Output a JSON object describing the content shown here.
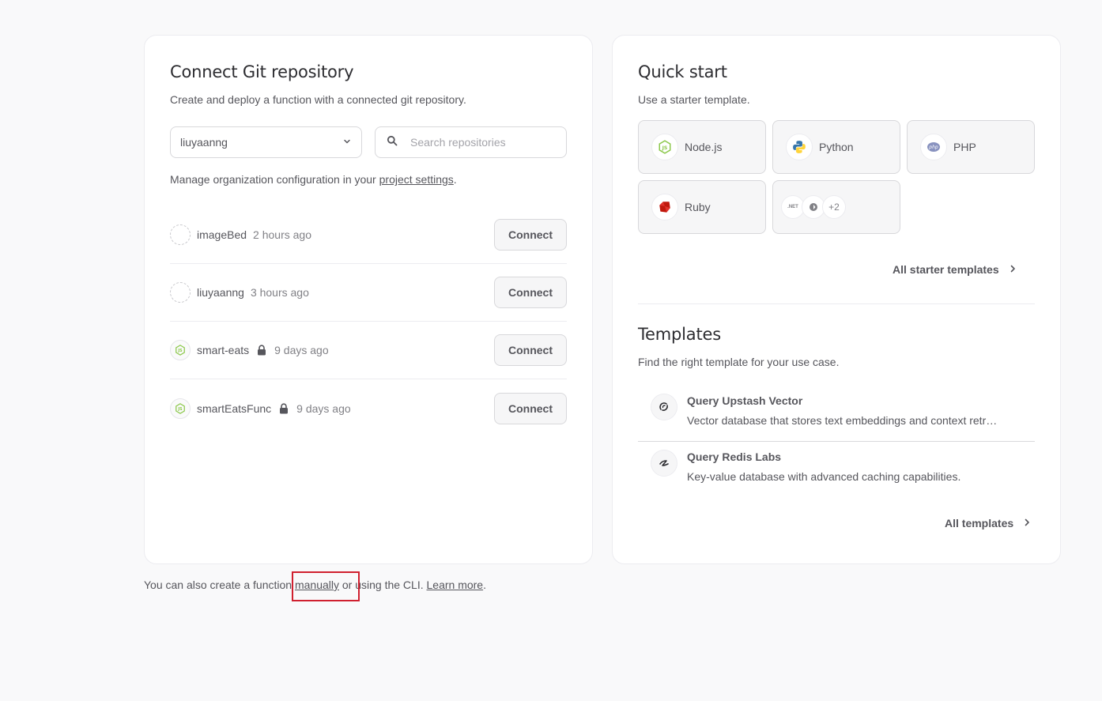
{
  "git": {
    "title": "Connect Git repository",
    "subtitle": "Create and deploy a function with a connected git repository.",
    "org_select": "liuyaanng",
    "search_placeholder": "Search repositories",
    "manage_prefix": "Manage organization configuration in your ",
    "manage_link": "project settings",
    "manage_suffix": ".",
    "connect_label": "Connect",
    "repos": [
      {
        "name": "imageBed",
        "time": "2 hours ago",
        "private": false,
        "icon": "empty-avatar-icon"
      },
      {
        "name": "liuyaanng",
        "time": "3 hours ago",
        "private": false,
        "icon": "empty-avatar-icon"
      },
      {
        "name": "smart-eats",
        "time": "9 days ago",
        "private": true,
        "icon": "nodejs-icon"
      },
      {
        "name": "smartEatsFunc",
        "time": "9 days ago",
        "private": true,
        "icon": "nodejs-icon"
      }
    ]
  },
  "quickstart": {
    "title": "Quick start",
    "subtitle": "Use a starter template.",
    "starters": [
      {
        "label": "Node.js",
        "icon": "nodejs-icon"
      },
      {
        "label": "Python",
        "icon": "python-icon"
      },
      {
        "label": "PHP",
        "icon": "php-icon"
      },
      {
        "label": "Ruby",
        "icon": "ruby-icon"
      }
    ],
    "more_starters": {
      "dotnet": ".NET",
      "count": "+2"
    },
    "all_starters_label": "All starter templates"
  },
  "templates": {
    "title": "Templates",
    "subtitle": "Find the right template for your use case.",
    "items": [
      {
        "title": "Query Upstash Vector",
        "desc": "Vector database that stores text embeddings and context retr…",
        "icon": "upstash-icon"
      },
      {
        "title": "Query Redis Labs",
        "desc": "Key-value database with advanced caching capabilities.",
        "icon": "redis-icon"
      }
    ],
    "all_templates_label": "All templates"
  },
  "footer": {
    "prefix": "You can also create a function ",
    "manual_link": "manually",
    "middle": " or using the CLI. ",
    "learn_link": "Learn more",
    "suffix": "."
  },
  "colors": {
    "highlight": "#d0202f",
    "nodejs": "#8cc84b",
    "php": "#8892bf",
    "ruby": "#c0180c",
    "python_blue": "#3776ab",
    "python_yellow": "#ffd43b"
  }
}
